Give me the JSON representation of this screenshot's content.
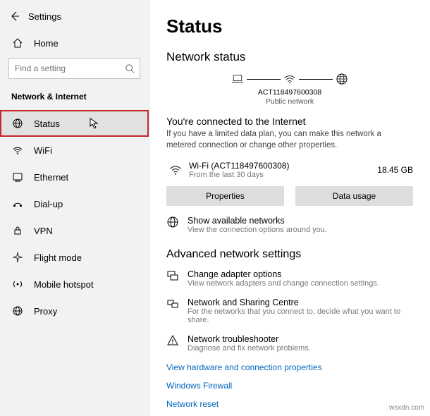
{
  "app": {
    "title": "Settings"
  },
  "sidebar": {
    "home_label": "Home",
    "search_placeholder": "Find a setting",
    "category": "Network & Internet",
    "items": [
      {
        "label": "Status",
        "icon": "globe-icon",
        "selected": true
      },
      {
        "label": "WiFi",
        "icon": "wifi-icon"
      },
      {
        "label": "Ethernet",
        "icon": "ethernet-icon"
      },
      {
        "label": "Dial-up",
        "icon": "dialup-icon"
      },
      {
        "label": "VPN",
        "icon": "vpn-icon"
      },
      {
        "label": "Flight mode",
        "icon": "airplane-icon"
      },
      {
        "label": "Mobile hotspot",
        "icon": "hotspot-icon"
      },
      {
        "label": "Proxy",
        "icon": "proxy-icon"
      }
    ]
  },
  "main": {
    "title": "Status",
    "section1": "Network status",
    "diagram": {
      "ssid": "ACT118497600308",
      "type": "Public network"
    },
    "connected_heading": "You're connected to the Internet",
    "connected_desc": "If you have a limited data plan, you can make this network a metered connection or change other properties.",
    "connection": {
      "name": "Wi-Fi (ACT118497600308)",
      "sub": "From the last 30 days",
      "usage": "18.45 GB"
    },
    "buttons": {
      "properties": "Properties",
      "data_usage": "Data usage"
    },
    "show_net": {
      "title": "Show available networks",
      "sub": "View the connection options around you."
    },
    "section2": "Advanced network settings",
    "adapter": {
      "title": "Change adapter options",
      "sub": "View network adapters and change connection settings."
    },
    "sharing": {
      "title": "Network and Sharing Centre",
      "sub": "For the networks that you connect to, decide what you want to share."
    },
    "troubleshoot": {
      "title": "Network troubleshooter",
      "sub": "Diagnose and fix network problems."
    },
    "links": {
      "hw": "View hardware and connection properties",
      "fw": "Windows Firewall",
      "reset": "Network reset"
    }
  },
  "watermark": "wsxdn.com"
}
